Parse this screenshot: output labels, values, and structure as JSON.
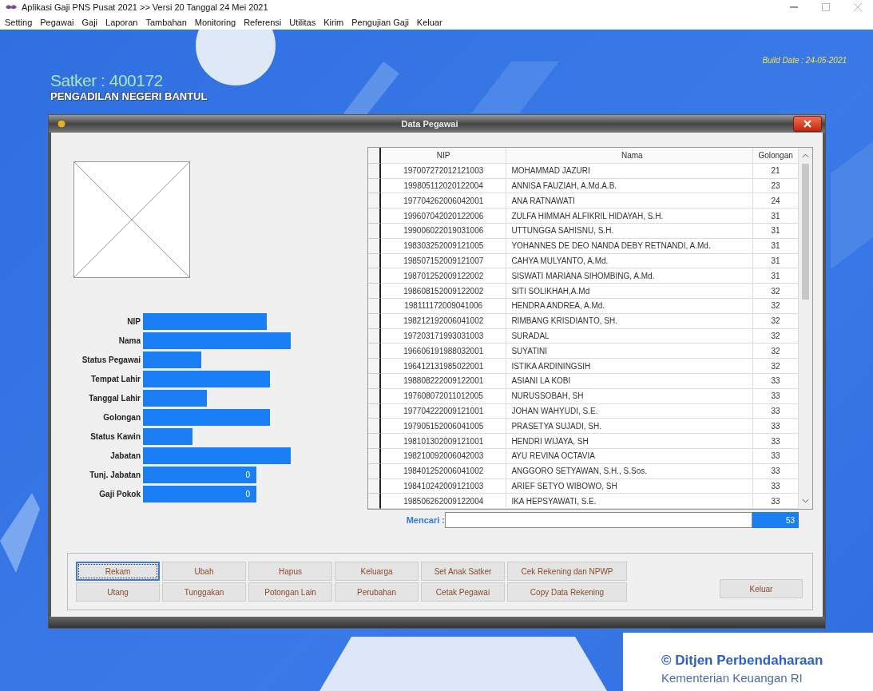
{
  "window": {
    "title": "Aplikasi Gaji PNS Pusat 2021 >> Versi 20 Tanggal 24 Mei 2021"
  },
  "menu": [
    "Setting",
    "Pegawai",
    "Gaji",
    "Laporan",
    "Tambahan",
    "Monitoring",
    "Referensi",
    "Utilitas",
    "Kirim",
    "Pengujian Gaji",
    "Keluar"
  ],
  "header": {
    "satker": "Satker : 400172",
    "office": "PENGADILAN NEGERI BANTUL",
    "build_date": "Build Date : 24-05-2021"
  },
  "dialog": {
    "title": "Data Pegawai",
    "fields": [
      {
        "label": "NIP"
      },
      {
        "label": "Nama"
      },
      {
        "label": "Status Pegawai"
      },
      {
        "label": "Tempat Lahir"
      },
      {
        "label": "Tanggal Lahir"
      },
      {
        "label": "Golongan"
      },
      {
        "label": "Status Kawin"
      },
      {
        "label": "Jabatan"
      },
      {
        "label": "Tunj. Jabatan",
        "value": "0"
      },
      {
        "label": "Gaji Pokok",
        "value": "0"
      }
    ],
    "table": {
      "columns": [
        "NIP",
        "Nama",
        "Golongan"
      ],
      "rows": [
        [
          "197007272012121003",
          "MOHAMMAD JAZURI",
          "21"
        ],
        [
          "199805112020122004",
          "ANNISA FAUZIAH, A.Md.A.B.",
          "23"
        ],
        [
          "197704262006042001",
          "ANA RATNAWATI",
          "24"
        ],
        [
          "199607042020122006",
          "ZULFA HIMMAH ALFIKRIL HIDAYAH, S.H.",
          "31"
        ],
        [
          "199006022019031006",
          "UTTUNGGA SAHISNU, S.H.",
          "31"
        ],
        [
          "198303252009121005",
          "YOHANNES DE DEO NANDA DEBY RETNANDI, A.Md.",
          "31"
        ],
        [
          "198507152009121007",
          "CAHYA MULYANTO, A.Md.",
          "31"
        ],
        [
          "198701252009122002",
          "SISWATI MARIANA SIHOMBING, A.Md.",
          "31"
        ],
        [
          "198608152009122002",
          "SITI SOLIKHAH,A.Md",
          "32"
        ],
        [
          "198111172009041006",
          "HENDRA ANDREA, A.Md.",
          "32"
        ],
        [
          "198212192006041002",
          "RIMBANG KRISDIANTO, SH.",
          "32"
        ],
        [
          "197203171993031003",
          "SURADAL",
          "32"
        ],
        [
          "196606191988032001",
          "SUYATINI",
          "32"
        ],
        [
          "196412131985022001",
          "ISTIKA ARDININGSIH",
          "32"
        ],
        [
          "198808222009122001",
          "ASIANI LA KOBI",
          "33"
        ],
        [
          "197608072011012005",
          "NURUSSOBAH, SH",
          "33"
        ],
        [
          "197704222009121001",
          "JOHAN WAHYUDI, S.E.",
          "33"
        ],
        [
          "197905152006041005",
          "PRASETYA SUJADI, SH.",
          "33"
        ],
        [
          "198101302009121001",
          "HENDRI WIJAYA, SH",
          "33"
        ],
        [
          "198210092006042003",
          "AYU REVINA OCTAVIA",
          "33"
        ],
        [
          "198401252006041002",
          "ANGGORO SETYAWAN, S.H., S.Sos.",
          "33"
        ],
        [
          "198410242009121003",
          "ARIEF SETYO WIBOWO, SH",
          "33"
        ],
        [
          "198506262009122004",
          "IKA HEPSYAWATI, S.E.",
          "33"
        ]
      ]
    },
    "search": {
      "label": "Mencari :",
      "count": "53"
    },
    "buttons": [
      [
        {
          "label": "Rekam",
          "selected": true
        },
        {
          "label": "Ubah",
          "selected": false
        },
        {
          "label": "Hapus",
          "selected": false
        },
        {
          "label": "Keluarga",
          "selected": false
        },
        {
          "label": "Set Anak Satker",
          "selected": false
        },
        {
          "label": "Cek Rekening  dan NPWP",
          "selected": false
        }
      ],
      [
        {
          "label": "Utang",
          "selected": false
        },
        {
          "label": "Tunggakan",
          "selected": false
        },
        {
          "label": "Potongan Lain",
          "selected": false
        },
        {
          "label": "Perubahan",
          "selected": false
        },
        {
          "label": "Cetak Pegawai",
          "selected": false
        },
        {
          "label": "Copy Data Rekening",
          "selected": false
        }
      ]
    ],
    "close_button": "Keluar"
  },
  "footer": {
    "copyright": "© Ditjen Perbendaharaan",
    "ministry": "Kementerian Keuangan RI"
  }
}
